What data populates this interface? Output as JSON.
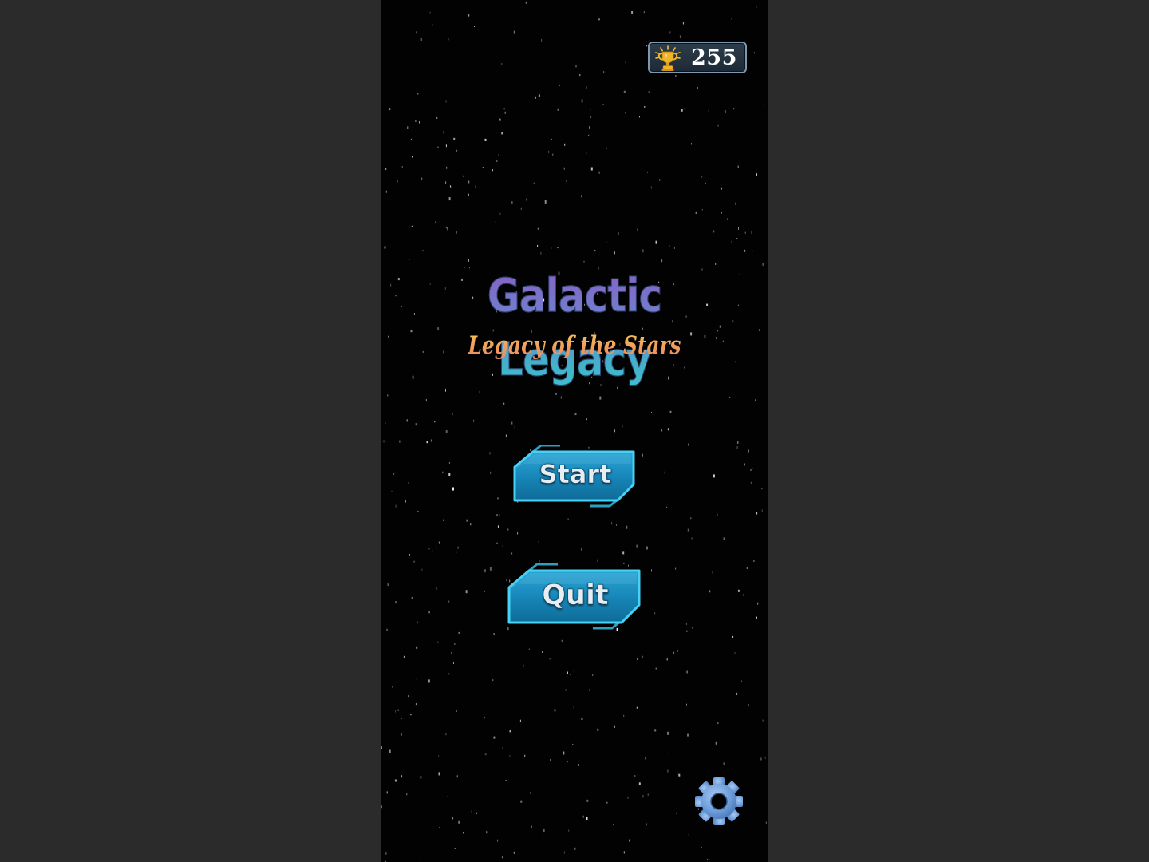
{
  "game": {
    "title": "Galactic Legacy",
    "subtitle": "Legacy of the Stars",
    "score": "255"
  },
  "menu": {
    "start_label": "Start",
    "quit_label": "Quit"
  },
  "icons": {
    "score": "trophy-icon",
    "settings": "gear-icon"
  },
  "colors": {
    "page_background": "#2a2b2a",
    "game_background": "#020202",
    "button_fill": "#1a8fc0",
    "button_border": "#35c3ef",
    "title_gradient_top": "#8466c6",
    "title_gradient_bottom": "#3fbfd2",
    "subtitle_gradient_top": "#f3cf5f",
    "subtitle_gradient_bottom": "#d98a73",
    "gear": "#6f9fdc"
  }
}
